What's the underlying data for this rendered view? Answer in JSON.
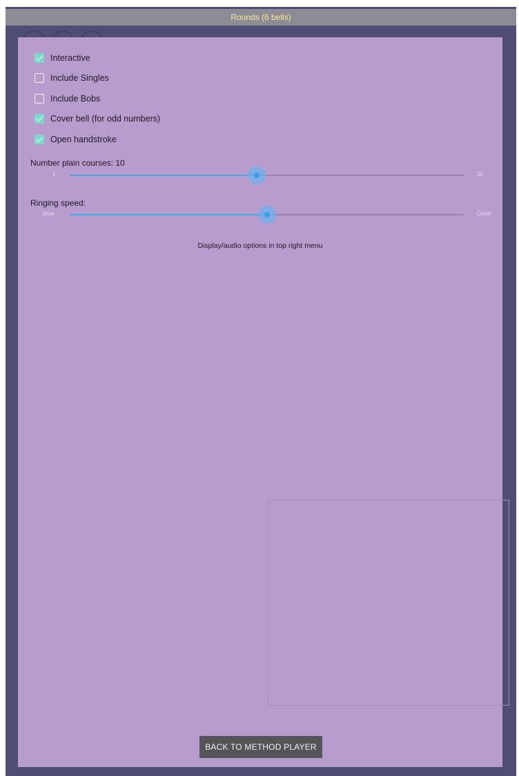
{
  "title": "Rounds (6 bells)",
  "options": [
    {
      "label": "Interactive",
      "checked": true
    },
    {
      "label": "Include Singles",
      "checked": false
    },
    {
      "label": "Include Bobs",
      "checked": false
    },
    {
      "label": "Cover bell (for odd numbers)",
      "checked": true
    },
    {
      "label": "Open handstroke",
      "checked": true
    }
  ],
  "courses_slider": {
    "label": "Number plain courses: 10",
    "min_label": "1",
    "max_label": "20",
    "min": 1,
    "max": 20,
    "value": 10
  },
  "speed_slider": {
    "label": "Ringing speed:",
    "min_label": "Slow",
    "max_label": "Quick",
    "value_fraction": 0.5
  },
  "note": "Display/audio options in top right menu",
  "back_button": "BACK TO METHOD PLAYER",
  "colors": {
    "panel": "#b89ccd",
    "frame": "#4e4d73",
    "checkbox_on": "#7ed7c9",
    "slider_accent": "#3fa8e8",
    "title_text": "#f4e9a0"
  }
}
